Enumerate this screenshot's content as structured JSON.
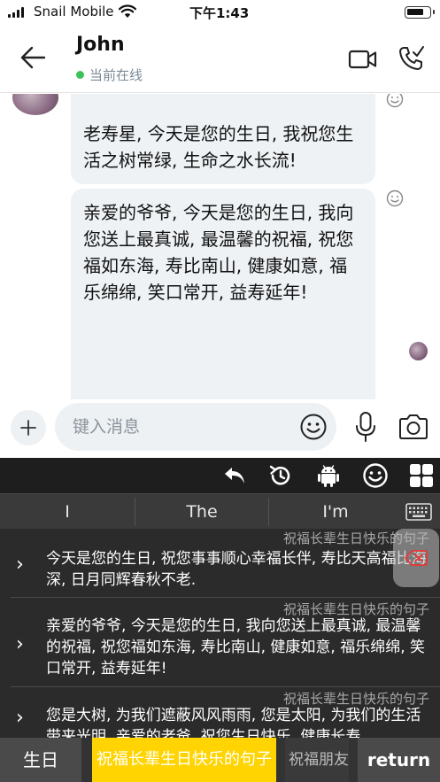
{
  "status_bar": {
    "carrier": "Snail Mobile",
    "time": "下午1:43",
    "icons": [
      "signal-icon",
      "wifi-icon",
      "battery-icon"
    ]
  },
  "header": {
    "contact_name": "John",
    "presence": "当前在线",
    "presence_color": "#3cc25a",
    "icons": [
      "back-arrow-icon",
      "video-call-icon",
      "phone-call-icon"
    ]
  },
  "chat": {
    "messages": [
      {
        "text": "老寿星, 今天是您的生日, 我祝您生活之树常绿, 生命之水长流!"
      },
      {
        "text": "亲爱的爷爷, 今天是您的生日, 我向您送上最真诚, 最温馨的祝福, 祝您福如东海, 寿比南山, 健康如意, 福乐绵绵, 笑口常开, 益寿延年!"
      }
    ],
    "bubble_color": "#eef2f5"
  },
  "input_bar": {
    "placeholder": "键入消息",
    "icons": [
      "plus-icon",
      "emoji-icon",
      "microphone-icon",
      "camera-icon"
    ]
  },
  "keyboard": {
    "toolbar_icons": [
      "undo-icon",
      "history-icon",
      "android-icon",
      "smiley-icon",
      "grid-icon"
    ],
    "suggestions": [
      "I",
      "The",
      "I'm"
    ],
    "phrases": [
      {
        "category": "祝福长辈生日快乐的句子",
        "text": "今天是您的生日, 祝您事事顺心幸福长伴, 寿比天高福比海深, 日月同辉春秋不老."
      },
      {
        "category": "祝福长辈生日快乐的句子",
        "text": "亲爱的爷爷, 今天是您的生日, 我向您送上最真诚, 最温馨的祝福, 祝您福如东海, 寿比南山, 健康如意, 福乐绵绵, 笑口常开, 益寿延年!"
      },
      {
        "category": "祝福长辈生日快乐的句子",
        "text": "您是大树, 为我们遮蔽风风雨雨, 您是太阳, 为我们的生活带来光明. 亲爱的老爸, 祝您生日快乐, 健康长寿"
      }
    ],
    "tabs": {
      "birthday": "生日",
      "elders": "祝福长辈生日快乐的句子",
      "friends": "祝福朋友",
      "return": "return"
    },
    "accent_color": "#ffd400",
    "delete_color": "#e53935"
  }
}
